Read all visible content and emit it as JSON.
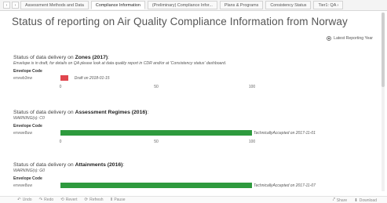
{
  "nav": {
    "prev_icon": "chevron-left-icon",
    "prev_label": "‹",
    "next_icon": "chevron-right-icon",
    "next_label": "›"
  },
  "tabs": [
    {
      "label": "Assessment Methods and Data",
      "active": false
    },
    {
      "label": "Compliance Information",
      "active": true
    },
    {
      "label": "(Preliminary) Compliance Infor...",
      "active": false
    },
    {
      "label": "Plans & Programs",
      "active": false
    },
    {
      "label": "Consistency Status",
      "active": false
    },
    {
      "label": "Tier1: QA ›",
      "active": false
    }
  ],
  "page": {
    "title": "Status of reporting on Air Quality Compliance Information from Norway"
  },
  "legend": {
    "radio_label": "Latest Reporting Year"
  },
  "sections": [
    {
      "title_prefix": "Status of data delivery on ",
      "title_bold": "Zones (2017)",
      "title_suffix": ":",
      "subtitle": "Envelope is in draft, for details on QA please look at data quality report in CDR and/or at 'Consistency status' dashboard.",
      "env_header": "Envelope Code",
      "env_code": "envwb3nw",
      "status_text": "Draft on 2018-01-15",
      "progress": 4,
      "color": "#e0464e",
      "ticks": [
        "0",
        "50",
        "100"
      ]
    },
    {
      "title_prefix": "Status of data delivery on ",
      "title_bold": "Assessment Regimes (2016)",
      "title_suffix": ":",
      "subtitle": "WARNING(s): C0",
      "env_header": "Envelope Code",
      "env_code": "envwe8uw",
      "status_text": "TechnicallyAccepted on 2017-11-01",
      "progress": 100,
      "color": "#2e9a3e",
      "ticks": [
        "0",
        "50",
        "100"
      ]
    },
    {
      "title_prefix": "Status of data delivery on ",
      "title_bold": "Attainments (2016)",
      "title_suffix": ":",
      "subtitle": "WARNING(s): G0",
      "env_header": "Envelope Code",
      "env_code": "envwe8uw",
      "status_text": "TechnicallyAccepted on 2017-11-07",
      "progress": 100,
      "color": "#2e9a3e",
      "ticks": [
        "0",
        "50",
        "100"
      ]
    }
  ],
  "bottombar": {
    "items": [
      {
        "icon": "undo-icon",
        "glyph": "↶",
        "label": "Undo"
      },
      {
        "icon": "redo-icon",
        "glyph": "↷",
        "label": "Redo"
      },
      {
        "icon": "revert-icon",
        "glyph": "⟲",
        "label": "Revert"
      },
      {
        "icon": "refresh-icon",
        "glyph": "⟳",
        "label": "Refresh"
      },
      {
        "icon": "pause-icon",
        "glyph": "Ⅱ",
        "label": "Pause"
      }
    ],
    "right": [
      {
        "icon": "share-icon",
        "glyph": "⤤",
        "label": "Share"
      },
      {
        "icon": "download-icon",
        "glyph": "⬇",
        "label": "Download"
      }
    ]
  }
}
